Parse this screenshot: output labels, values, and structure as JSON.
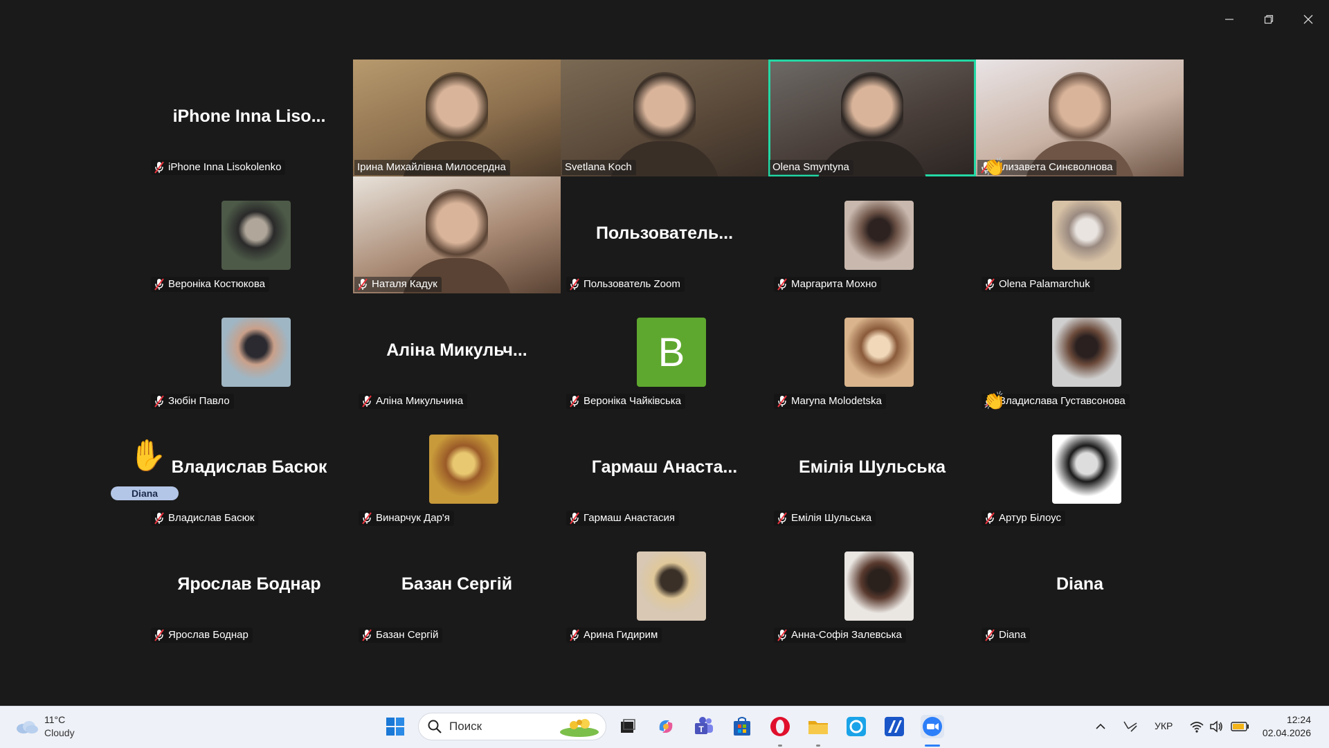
{
  "window": {
    "controls": [
      "minimize-icon",
      "restore-icon",
      "close-icon"
    ]
  },
  "tiles": [
    {
      "kind": "name",
      "name": "iPhone Inna Liso...",
      "label": "iPhone Inna Lisokolenko",
      "muted": true
    },
    {
      "kind": "video",
      "label": "Ірина Михайлівна Милосердна",
      "muted": false,
      "colors": [
        "#b89a6e",
        "#8c6f4d",
        "#4b3a2a"
      ]
    },
    {
      "kind": "video",
      "label": "Svetlana Koch",
      "muted": false,
      "colors": [
        "#7a6a54",
        "#5b4a3a",
        "#3a2f27"
      ]
    },
    {
      "kind": "video",
      "label": "Olena Smyntyna",
      "muted": false,
      "active": true,
      "colors": [
        "#6d6a66",
        "#4a3f3a",
        "#2b2522"
      ]
    },
    {
      "kind": "video",
      "label": "Єлизавета Синєволнова",
      "muted": true,
      "colors": [
        "#e9e4e6",
        "#c9b2a4",
        "#6e5546"
      ]
    },
    {
      "kind": "avatar",
      "label": "Вероніка Костюкова",
      "muted": true,
      "colors": [
        "#4d5a48",
        "#2a2a2a",
        "#b0a79a"
      ]
    },
    {
      "kind": "video",
      "label": "Наталя Кадук",
      "muted": true,
      "colors": [
        "#e8e2da",
        "#a98a74",
        "#5a4334"
      ]
    },
    {
      "kind": "name",
      "name": "Пользователь...",
      "label": "Пользователь Zoom",
      "muted": true
    },
    {
      "kind": "avatar",
      "label": "Маргарита Мохно",
      "muted": true,
      "colors": [
        "#c9b8ae",
        "#6e5448",
        "#2d2220"
      ]
    },
    {
      "kind": "avatar",
      "label": "Olena Palamarchuk",
      "muted": true,
      "colors": [
        "#d8c2a6",
        "#9a8a80",
        "#e9e4e0"
      ],
      "hand": true
    },
    {
      "kind": "avatar",
      "label": "Зюбін Павло",
      "muted": true,
      "colors": [
        "#9fb6c4",
        "#c9a08a",
        "#2a2a30"
      ]
    },
    {
      "kind": "name",
      "name": "Аліна Микульч...",
      "label": "Аліна Микульчина",
      "muted": true
    },
    {
      "kind": "letter",
      "letter": "B",
      "label": "Вероніка Чайківська",
      "muted": true
    },
    {
      "kind": "avatar",
      "label": "Maryna Molodetska",
      "muted": true,
      "colors": [
        "#d9b48c",
        "#8a5a3a",
        "#f0d8b8"
      ]
    },
    {
      "kind": "avatar",
      "label": "Владислава Густавсонова",
      "muted": true,
      "colors": [
        "#cfcfcf",
        "#6b4a3a",
        "#2a2020"
      ]
    },
    {
      "kind": "name",
      "name": "Владислав Басюк",
      "label": "Владислав Басюк",
      "muted": true,
      "bighand": true,
      "badge": "Diana"
    },
    {
      "kind": "avatar",
      "label": "Винарчук Дар'я",
      "muted": true,
      "colors": [
        "#c89a3a",
        "#9a5a28",
        "#e8c870"
      ]
    },
    {
      "kind": "name",
      "name": "Гармаш  Анаста...",
      "label": "Гармаш Анастасия",
      "muted": true
    },
    {
      "kind": "name",
      "name": "Емілія Шульська",
      "label": "Емілія Шульська",
      "muted": true
    },
    {
      "kind": "avatar",
      "label": "Артур Білоус",
      "muted": true,
      "colors": [
        "#ffffff",
        "#1a1a1a",
        "#dddddd"
      ],
      "hand": true
    },
    {
      "kind": "name",
      "name": "Ярослав Боднар",
      "label": "Ярослав Боднар",
      "muted": true
    },
    {
      "kind": "name",
      "name": "Базан Сергій",
      "label": "Базан Сергій",
      "muted": true
    },
    {
      "kind": "avatar",
      "label": "Арина Гидирим",
      "muted": true,
      "colors": [
        "#d8c8b4",
        "#e0c89a",
        "#3a3028"
      ]
    },
    {
      "kind": "avatar",
      "label": "Анна-Софія Залевська",
      "muted": true,
      "colors": [
        "#eae6e2",
        "#5a3a2e",
        "#2a201c"
      ]
    },
    {
      "kind": "name",
      "name": "Diana",
      "label": "Diana",
      "muted": true
    }
  ],
  "taskbar": {
    "weather": {
      "temp": "11°C",
      "condition": "Cloudy",
      "icon": "cloud-icon"
    },
    "search_placeholder": "Поиск",
    "apps": [
      "windows-start-icon",
      "task-view-icon",
      "copilot-icon",
      "teams-icon",
      "store-icon",
      "opera-icon",
      "file-explorer-icon",
      "cortana-icon",
      "app-icon",
      "zoom-icon"
    ],
    "tray": {
      "language": "УКР"
    },
    "clock": {
      "time": "12:24",
      "date": "02.04.2026"
    }
  }
}
